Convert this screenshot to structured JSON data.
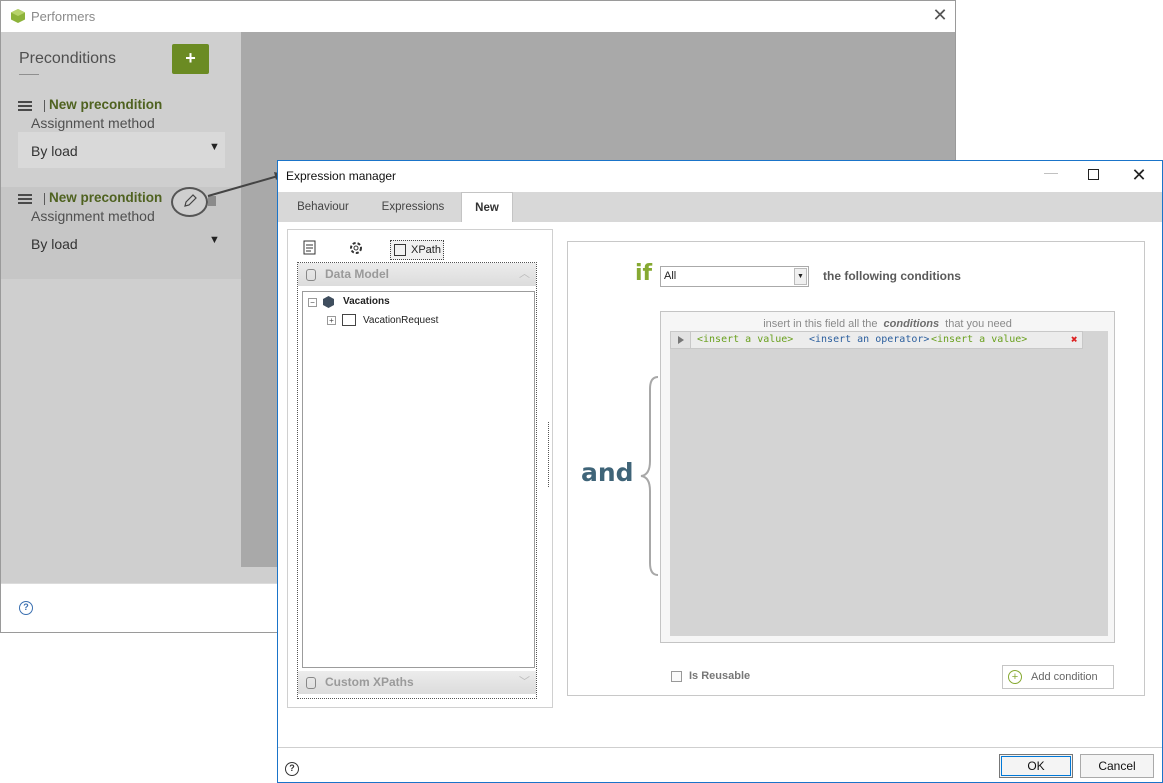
{
  "performers": {
    "title": "Performers",
    "close_glyph": "✕",
    "heading": "Preconditions",
    "add_label": "+",
    "help_glyph": "?",
    "preconditions": [
      {
        "name": "New precondition",
        "method_label": "Assignment method",
        "method_value": "By load",
        "arrow": "▼"
      },
      {
        "name": "New precondition",
        "method_label": "Assignment method",
        "method_value": "By load",
        "arrow": "▼"
      }
    ],
    "icons": [
      "app-icon",
      "list-icon",
      "pencil-icon",
      "trash-icon",
      "help-icon",
      "close-icon"
    ]
  },
  "expression_manager": {
    "title": "Expression manager",
    "min_glyph": "—",
    "close_glyph": "✕",
    "tabs": [
      {
        "label": "Behaviour",
        "active": false
      },
      {
        "label": "Expressions",
        "active": false
      },
      {
        "label": "New",
        "active": true
      }
    ],
    "toolbar": {
      "xpath_label": "XPath"
    },
    "data_model": {
      "header": "Data Model",
      "tree": [
        {
          "label": "Vacations",
          "expander": "−"
        },
        {
          "label": "VacationRequest",
          "expander": "+"
        }
      ]
    },
    "custom_xpaths_header": "Custom XPaths",
    "if_label": "if",
    "condition_select": "All",
    "following_label": "the following conditions",
    "and_label": "and",
    "hint": {
      "before": "insert in this field all the",
      "emphasis": "conditions",
      "after": "that you need"
    },
    "condition_row": {
      "value1": "<insert a value>",
      "operator": "<insert an operator>",
      "value2": "<insert a value>",
      "delete_glyph": "✖"
    },
    "is_reusable_label": "Is Reusable",
    "add_condition_label": "Add condition",
    "ok_label": "OK",
    "cancel_label": "Cancel",
    "help_glyph": "?",
    "colors": {
      "accent_green": "#86a932",
      "operator_blue": "#2c5f9e",
      "add_button_green": "#6b8b23",
      "focus_border": "#1a74c9"
    }
  }
}
